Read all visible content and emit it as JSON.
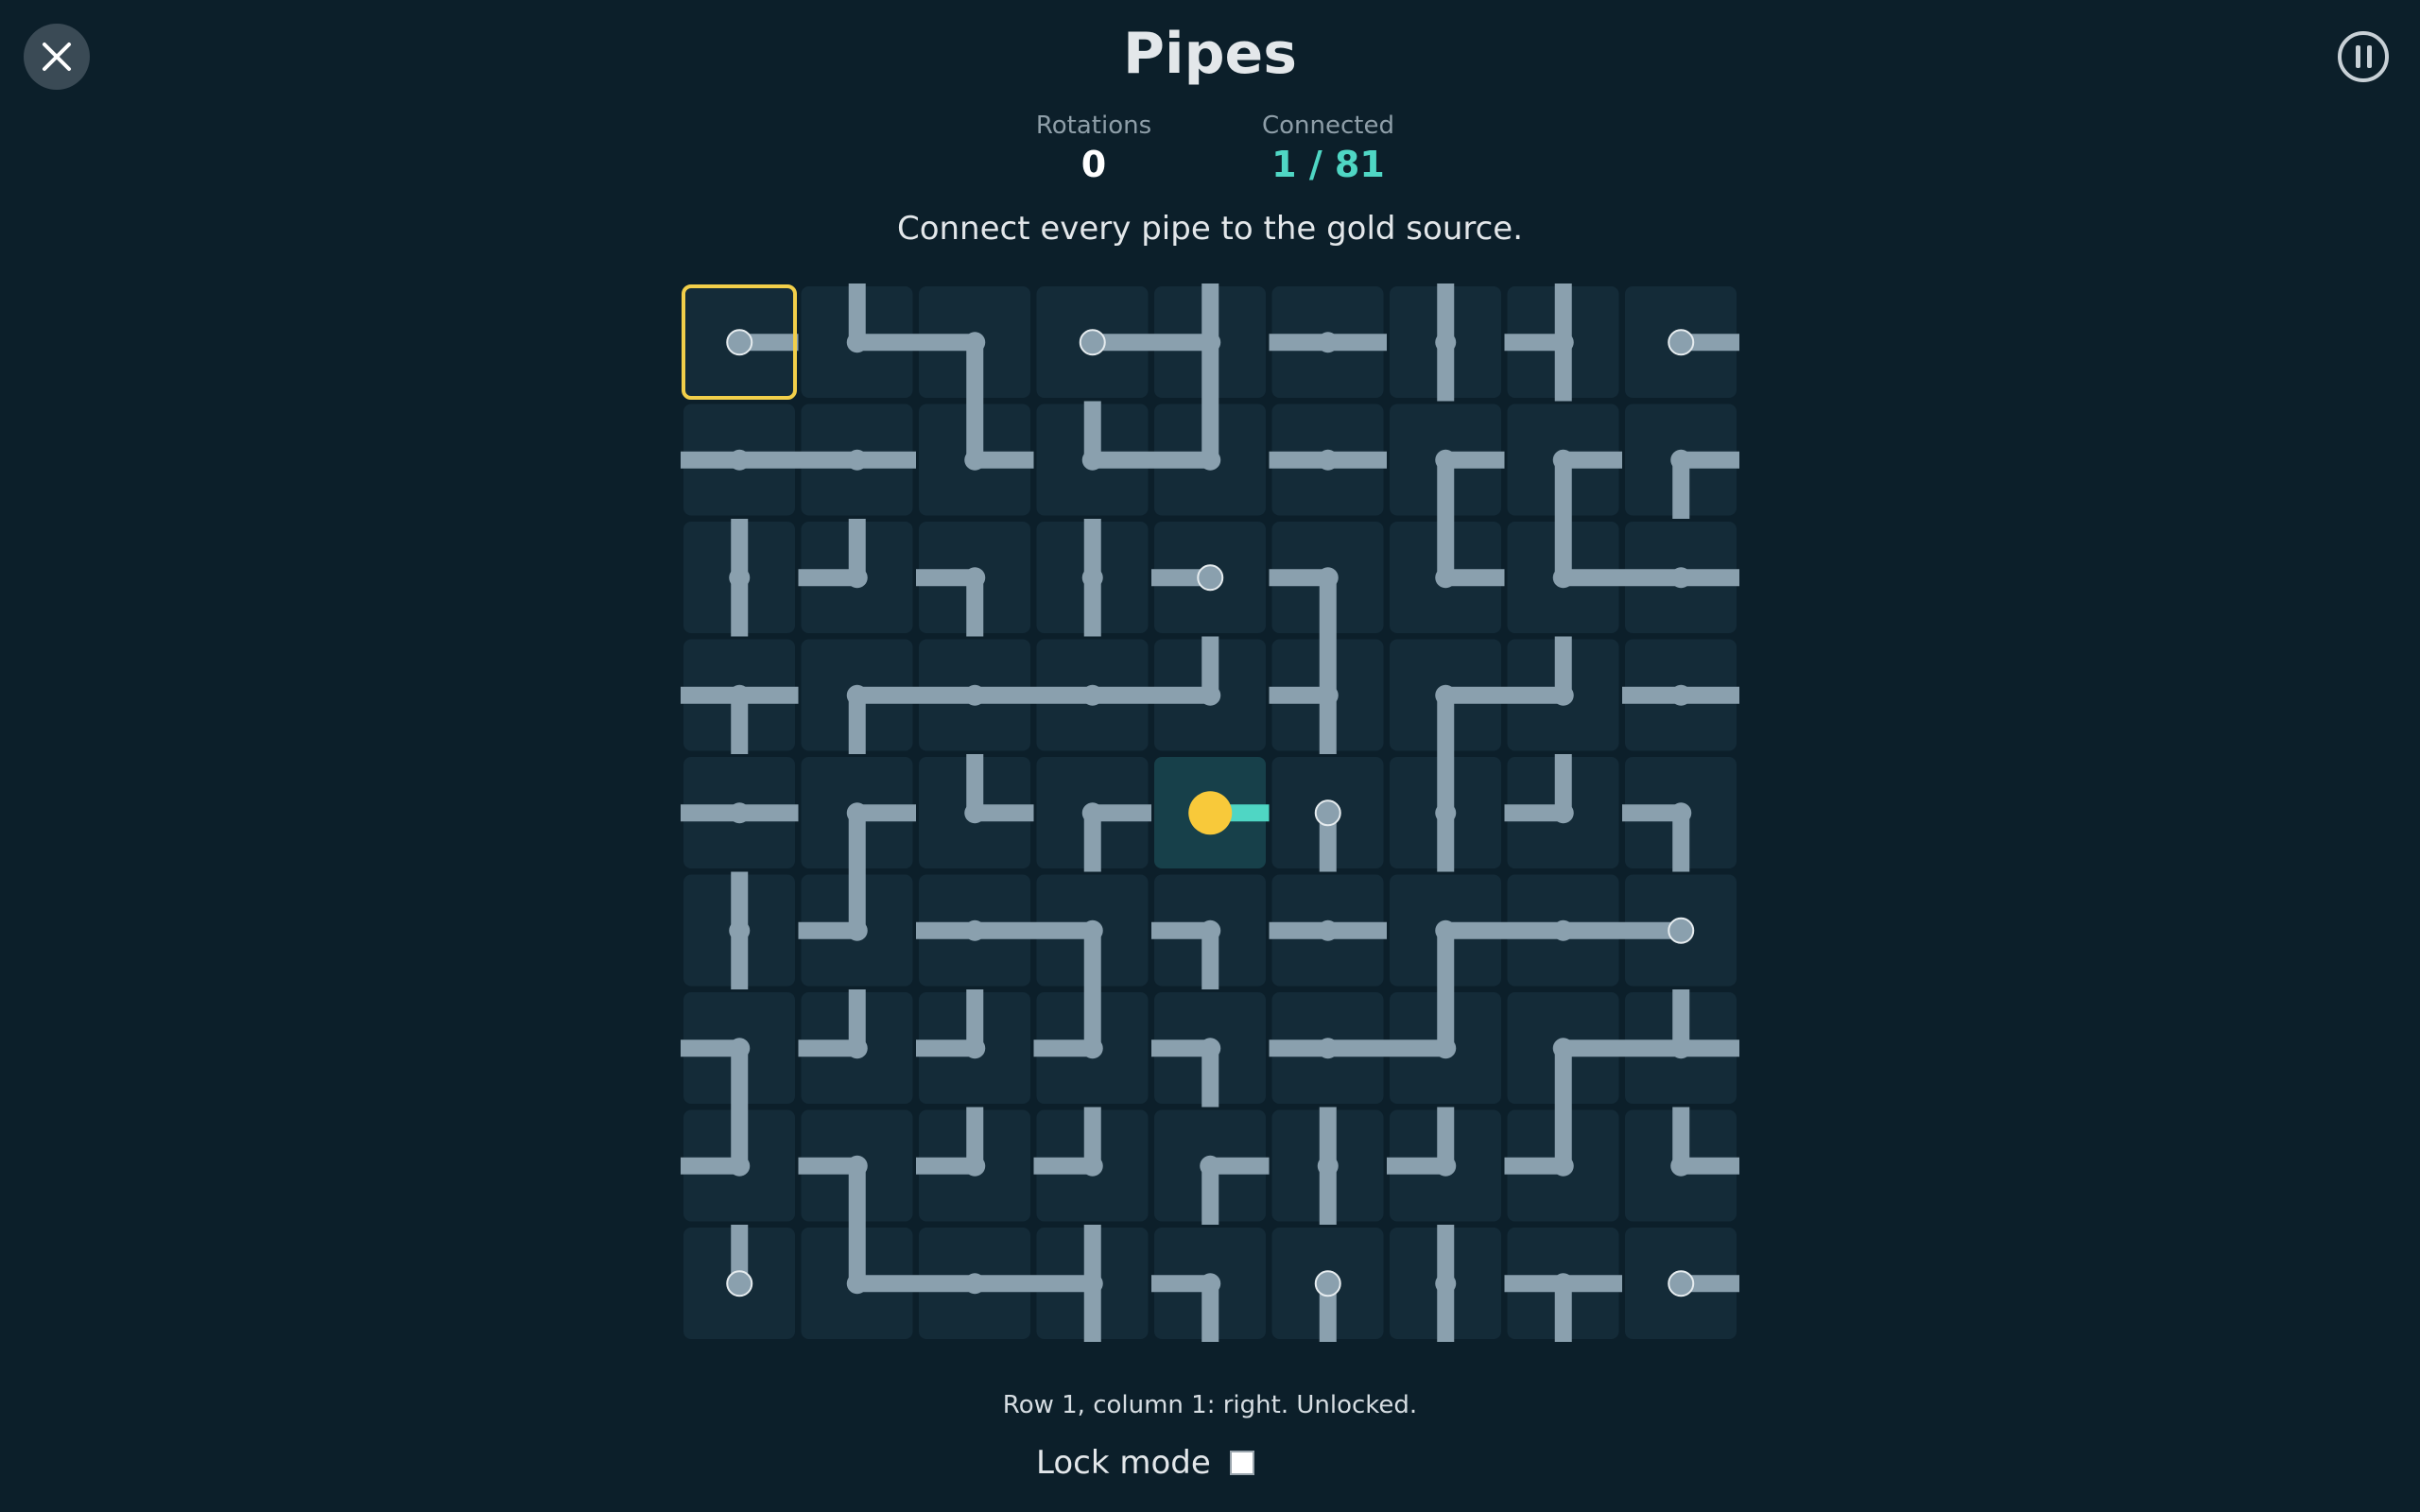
{
  "header": {
    "title": "Pipes",
    "close_icon": "close-icon",
    "pause_icon": "pause-icon"
  },
  "stats": {
    "rotations_label": "Rotations",
    "rotations_value": "0",
    "connected_label": "Connected",
    "connected_value": "1 / 81"
  },
  "instruction": "Connect every pipe to the gold source.",
  "board": {
    "rows": 9,
    "cols": 9,
    "source": [
      4,
      4
    ],
    "selected": [
      0,
      0
    ],
    "colors": {
      "pipe": "#8aa0ae",
      "connected": "#4fd6c4",
      "source": "#f8c93a",
      "tile": "#142b38",
      "selection": "#f2cf4a",
      "source_tile": "#17404a"
    },
    "tiles": [
      [
        "R",
        "NR",
        "WS",
        "R",
        "NWS",
        "RW",
        "NS",
        "NWS",
        "R"
      ],
      [
        "RW",
        "RW",
        "NR",
        "NR",
        "NW",
        "RW",
        "RS",
        "RS",
        "RS"
      ],
      [
        "NS",
        "NW",
        "WS",
        "NS",
        "W",
        "WS",
        "NR",
        "NR",
        "RW"
      ],
      [
        "WRS",
        "RS",
        "RW",
        "RW",
        "NW",
        "NWS",
        "RS",
        "NW",
        "RW"
      ],
      [
        "RW",
        "RS",
        "NR",
        "RS",
        "R",
        "S",
        "NS",
        "NW",
        "WS"
      ],
      [
        "NS",
        "NW",
        "RW",
        "WS",
        "WS",
        "RW",
        "RS",
        "RW",
        "W"
      ],
      [
        "WS",
        "NW",
        "NW",
        "NW",
        "WS",
        "RW",
        "NW",
        "RS",
        "NRW"
      ],
      [
        "NW",
        "WS",
        "NW",
        "NW",
        "RS",
        "NS",
        "NW",
        "NW",
        "NR"
      ],
      [
        "N",
        "NR",
        "RW",
        "NWS",
        "WS",
        "S",
        "NS",
        "WRS",
        "R"
      ]
    ]
  },
  "status": "Row 1, column 1: right. Unlocked.",
  "lock": {
    "label": "Lock mode",
    "checked": false
  }
}
